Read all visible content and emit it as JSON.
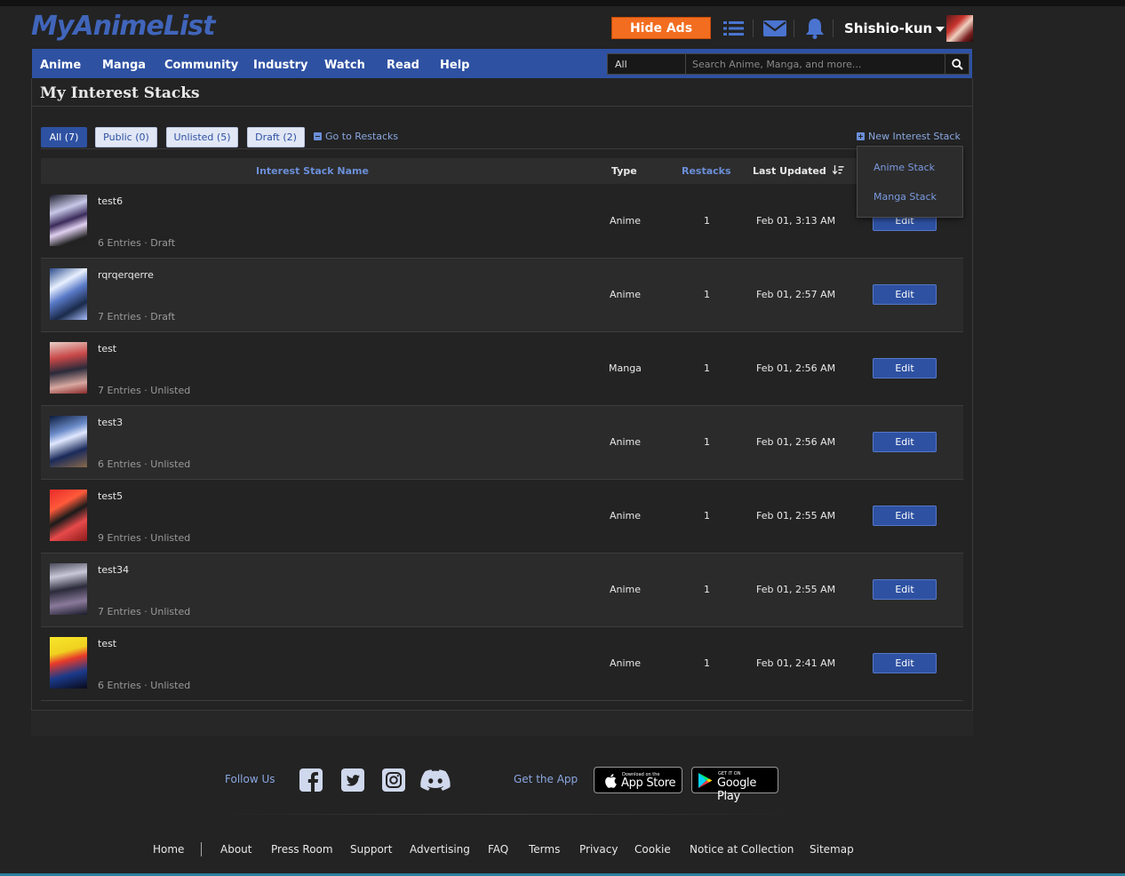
{
  "header": {
    "logo": "MyAnimeList",
    "hide_ads": "Hide Ads",
    "username": "Shishio-kun",
    "icons": [
      "list-icon",
      "mail-icon",
      "bell-icon"
    ]
  },
  "nav": {
    "items": [
      "Anime",
      "Manga",
      "Community",
      "Industry",
      "Watch",
      "Read",
      "Help"
    ],
    "search_type": "All",
    "search_placeholder": "Search Anime, Manga, and more..."
  },
  "page": {
    "title": "My Interest Stacks",
    "tabs": [
      "All (7)",
      "Public (0)",
      "Unlisted (5)",
      "Draft (2)"
    ],
    "go_to_restacks": "Go to Restacks",
    "new_stack": "New Interest Stack",
    "dropdown": [
      "Anime Stack",
      "Manga Stack"
    ]
  },
  "table": {
    "headers": {
      "name": "Interest Stack Name",
      "type": "Type",
      "restacks": "Restacks",
      "updated": "Last Updated"
    },
    "edit_label": "Edit",
    "rows": [
      {
        "name": "test6",
        "meta": "6 Entries · Draft",
        "type": "Anime",
        "restacks": "1",
        "updated": "Feb 01, 3:13 AM"
      },
      {
        "name": "rqrqerqerre",
        "meta": "7 Entries · Draft",
        "type": "Anime",
        "restacks": "1",
        "updated": "Feb 01, 2:57 AM"
      },
      {
        "name": "test",
        "meta": "7 Entries · Unlisted",
        "type": "Manga",
        "restacks": "1",
        "updated": "Feb 01, 2:56 AM"
      },
      {
        "name": "test3",
        "meta": "6 Entries · Unlisted",
        "type": "Anime",
        "restacks": "1",
        "updated": "Feb 01, 2:56 AM"
      },
      {
        "name": "test5",
        "meta": "9 Entries · Unlisted",
        "type": "Anime",
        "restacks": "1",
        "updated": "Feb 01, 2:55 AM"
      },
      {
        "name": "test34",
        "meta": "7 Entries · Unlisted",
        "type": "Anime",
        "restacks": "1",
        "updated": "Feb 01, 2:55 AM"
      },
      {
        "name": "test",
        "meta": "6 Entries · Unlisted",
        "type": "Anime",
        "restacks": "1",
        "updated": "Feb 01, 2:41 AM"
      }
    ]
  },
  "footer": {
    "follow_us": "Follow Us",
    "get_the_app": "Get the App",
    "app_store_small": "Download on the",
    "app_store_big": "App Store",
    "google_small": "GET IT ON",
    "google_big": "Google Play",
    "links": [
      "Home",
      "About",
      "Press Room",
      "Support",
      "Advertising",
      "FAQ",
      "Terms",
      "Privacy",
      "Cookie",
      "Notice at Collection",
      "Sitemap"
    ]
  },
  "colors": {
    "accent": "#2e51a2",
    "hide_ads": "#f26d1f",
    "background": "#232323"
  }
}
